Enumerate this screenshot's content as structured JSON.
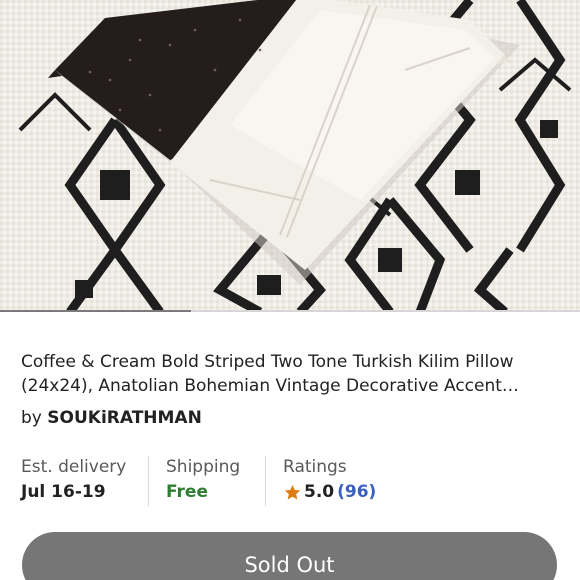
{
  "product": {
    "image_description_icon": "product-photo",
    "gallery_progress": 0.33,
    "title": "Coffee & Cream Bold Striped Two Tone Turkish Kilim Pillow (24x24), Anatolian Bohemian Vintage Decorative Accent…",
    "by_prefix": "by",
    "shop_name": "SOUKiRATHMAN"
  },
  "stats": {
    "delivery": {
      "label": "Est. delivery",
      "value": "Jul 16-19"
    },
    "shipping": {
      "label": "Shipping",
      "value": "Free"
    },
    "ratings": {
      "label": "Ratings",
      "score": "5.0",
      "count": "(96)",
      "star_icon": "star-icon"
    }
  },
  "actions": {
    "sold_out_label": "Sold Out"
  },
  "colors": {
    "free": "#2e7d32",
    "star": "#e07b13",
    "link": "#3b5fc0",
    "button": "#767676"
  }
}
